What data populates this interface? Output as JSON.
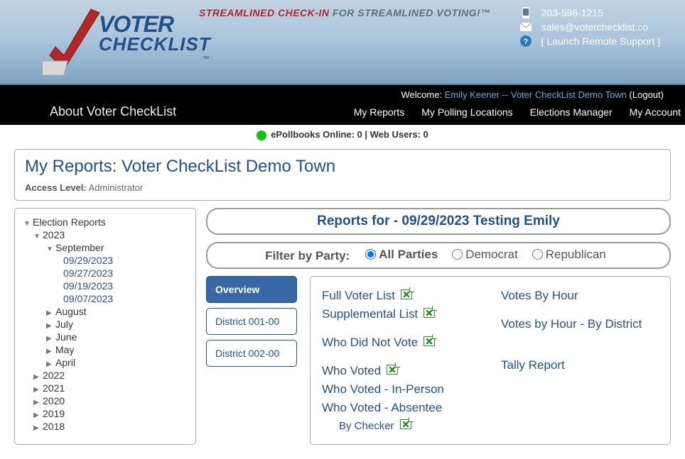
{
  "header": {
    "logo_line1": "VOTER",
    "logo_line2": "CHECKLIST",
    "logo_tm": "™",
    "tagline_red": "STREAMLINED CHECK-IN",
    "tagline_rest": " FOR STREAMLINED VOTING!™",
    "phone": "203-598-1215",
    "email": "sales@voterchecklist.co",
    "remote": "[ Launch Remote Support ]"
  },
  "welcome": {
    "prefix": "Welcome: ",
    "name": "Emily Keener",
    "sep": " -- ",
    "town": "Voter CheckList Demo Town",
    "logout_open": " (",
    "logout": "Logout",
    "logout_close": ")"
  },
  "nav": {
    "about": "About Voter CheckList",
    "reports": "My Reports",
    "polling": "My Polling Locations",
    "elections": "Elections Manager",
    "account": "My Account"
  },
  "status": {
    "text": "ePollbooks Online: 0 | Web Users: 0"
  },
  "title_panel": {
    "heading": "My Reports: Voter CheckList Demo Town",
    "access_label": "Access Level:",
    "access_value": " Administrator"
  },
  "tree": {
    "root": "Election Reports",
    "y2023": "2023",
    "sep": "September",
    "dates": [
      "09/29/2023",
      "09/27/2023",
      "09/19/2023",
      "09/07/2023"
    ],
    "months_collapsed": [
      "August",
      "July",
      "June",
      "May",
      "April"
    ],
    "years_collapsed": [
      "2022",
      "2021",
      "2020",
      "2019",
      "2018"
    ]
  },
  "reports_for": "Reports for - 09/29/2023 Testing Emily",
  "filter": {
    "label": "Filter by Party:",
    "all": "All Parties",
    "dem": "Democrat",
    "rep": "Republican"
  },
  "tabs": {
    "overview": "Overview",
    "d1": "District 001-00",
    "d2": "District 002-00"
  },
  "links": {
    "full": "Full Voter List",
    "supp": "Supplemental List",
    "didnot": "Who Did Not Vote",
    "voted": "Who Voted",
    "inperson": "Who Voted - In-Person",
    "absentee": "Who Voted - Absentee",
    "bychecker": "By Checker",
    "vbh": "Votes By Hour",
    "vbhd": "Votes by Hour - By District",
    "tally": "Tally Report"
  }
}
